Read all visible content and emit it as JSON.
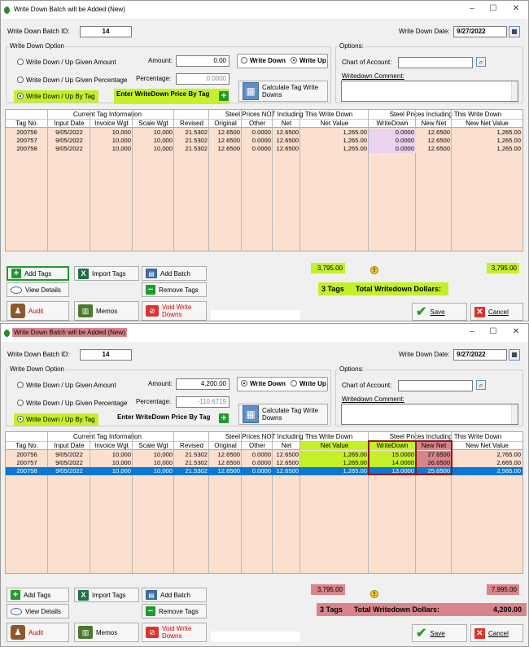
{
  "window1": {
    "title": "Write Down Batch will be Added  (New)",
    "batch_id_label": "Write Down Batch ID:",
    "batch_id": "14",
    "date_label": "Write Down Date:",
    "date": "9/27/2022",
    "option_group": "Write Down Option",
    "opt1": "Write Down / Up Given Amount",
    "opt2": "Write Down / Up Given Percentage",
    "opt3": "Write Down  / Up By Tag",
    "amount_label": "Amount:",
    "amount": "0.00",
    "percentage_label": "Percentage:",
    "percentage": "0.0000",
    "enter_price_label": "Enter WriteDown Price By Tag",
    "write_down_label": "Write Down",
    "write_up_label": "Write Up",
    "calc_label": "Calculate Tag Write Downs",
    "options_group": "Options:",
    "chart_label": "Chart of Account:",
    "comment_label": "Writedown Comment:",
    "hdr_group1": "Current Tag Information",
    "hdr_group2": "Steel Prices NOT Including This Write Down",
    "hdr_group3": "Steel Prices Including This Write Down",
    "cols": [
      "Tag No.",
      "Input Date",
      "Invoice Wgt",
      "Scale Wgt",
      "Revised",
      "Original",
      "Other",
      "Net",
      "Net Value",
      "WriteDown",
      "New Net",
      "New Net Value"
    ],
    "rows": [
      [
        "200756",
        "9/05/2022",
        "10,000",
        "10,000",
        "21.5302",
        "12.6500",
        "0.0000",
        "12.6500",
        "1,265.00",
        "0.0000",
        "12.6500",
        "1,265.00"
      ],
      [
        "200757",
        "9/05/2022",
        "10,000",
        "10,000",
        "21.5302",
        "12.6500",
        "0.0000",
        "12.6500",
        "1,265.00",
        "0.0000",
        "12.6500",
        "1,265.00"
      ],
      [
        "200758",
        "9/05/2022",
        "10,000",
        "10,000",
        "21.5302",
        "12.6500",
        "0.0000",
        "12.6500",
        "1,265.00",
        "0.0000",
        "12.6500",
        "1,265.00"
      ]
    ],
    "sum_net_value": "3,795.00",
    "sum_new_net_value": "3,795.00",
    "tags_count": "3 Tags",
    "total_label": "Total Writedown Dollars:",
    "total_value": ""
  },
  "window2": {
    "title": "Write Down Batch will be Added  (New)",
    "batch_id_label": "Write Down Batch ID:",
    "batch_id": "14",
    "date_label": "Write Down Date:",
    "date": "9/27/2022",
    "option_group": "Write Down Option",
    "opt1": "Write Down / Up Given Amount",
    "opt2": "Write Down / Up Given Percentage",
    "opt3": "Write Down  / Up By Tag",
    "amount_label": "Amount:",
    "amount": "4,200.00",
    "percentage_label": "Percentage:",
    "percentage": "-110.6719",
    "enter_price_label": "Enter WriteDown Price By Tag",
    "write_down_label": "Write Down",
    "write_up_label": "Write Up",
    "calc_label": "Calculate Tag Write Downs",
    "options_group": "Options:",
    "chart_label": "Chart of Account:",
    "comment_label": "Writedown Comment:",
    "hdr_group1": "Current Tag Information",
    "hdr_group2": "Steel Prices NOT Including This Write Down",
    "hdr_group3": "Steel Prices Including This Write Down",
    "cols": [
      "Tag No.",
      "Input Date",
      "Invoice Wgt",
      "Scale Wgt",
      "Revised",
      "Original",
      "Other",
      "Net",
      "Net Value",
      "WriteDown",
      "New Net",
      "New Net Value"
    ],
    "rows": [
      [
        "200756",
        "9/05/2022",
        "10,000",
        "10,000",
        "21.5302",
        "12.6500",
        "0.0000",
        "12.6500",
        "1,265.00",
        "15.0000",
        "27.6500",
        "2,765.00"
      ],
      [
        "200757",
        "9/05/2022",
        "10,000",
        "10,000",
        "21.5302",
        "12.6500",
        "0.0000",
        "12.6500",
        "1,265.00",
        "14.0000",
        "26.6500",
        "2,665.00"
      ],
      [
        "200758",
        "9/05/2022",
        "10,000",
        "10,000",
        "21.5302",
        "12.6500",
        "0.0000",
        "12.6500",
        "1,265.00",
        "13.0000",
        "25.6500",
        "2,565.00"
      ]
    ],
    "sum_net_value": "3,795.00",
    "sum_new_net_value": "7,995.00",
    "tags_count": "3 Tags",
    "total_label": "Total Writedown Dollars:",
    "total_value": "4,200.00"
  },
  "buttons": {
    "add_tags": "Add Tags",
    "import_tags": "Import Tags",
    "add_batch": "Add Batch",
    "view_details": "View Details",
    "remove_tags": "Remove Tags",
    "audit": "Audit",
    "memos": "Memos",
    "void": "Void Write Downs",
    "save": "Save",
    "cancel": "Cancel"
  },
  "colors": {
    "highlight_green": "#c4f02a",
    "highlight_red": "#d9848a",
    "grid_bg": "#fbe0cf",
    "selection_blue": "#0a78d7"
  }
}
